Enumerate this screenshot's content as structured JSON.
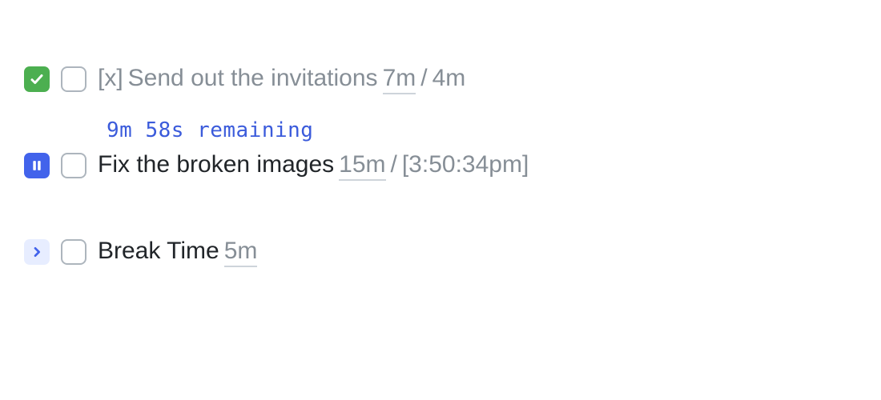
{
  "tasks": [
    {
      "prefix": "[x]",
      "title": "Send out the invitations",
      "estimate": "7m",
      "separator": "/",
      "actual": "4m"
    },
    {
      "remaining": "9m 58s remaining",
      "title": "Fix the broken images",
      "estimate": "15m",
      "separator": "/",
      "timestamp": "[3:50:34pm]"
    },
    {
      "title": "Break Time",
      "estimate": "5m"
    }
  ]
}
